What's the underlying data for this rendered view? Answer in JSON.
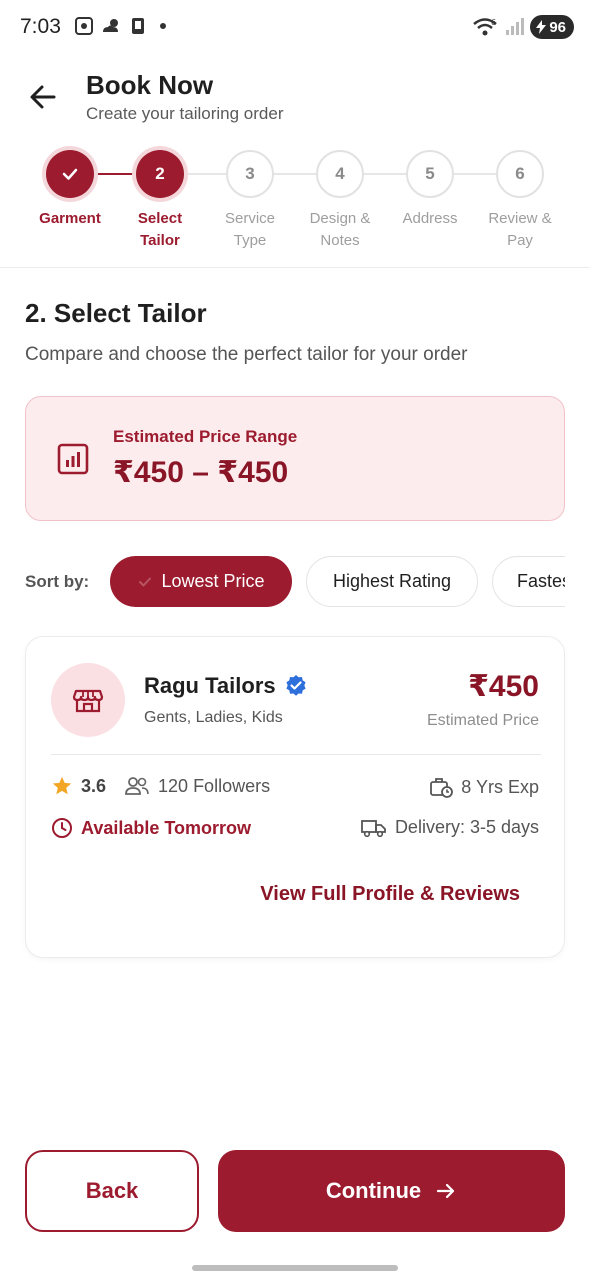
{
  "status_bar": {
    "time": "7:03",
    "battery": "96"
  },
  "header": {
    "title": "Book Now",
    "subtitle": "Create your tailoring order"
  },
  "stepper": [
    {
      "number": "1",
      "label_line1": "Garment",
      "label_line2": "",
      "state": "done"
    },
    {
      "number": "2",
      "label_line1": "Select",
      "label_line2": "Tailor",
      "state": "active"
    },
    {
      "number": "3",
      "label_line1": "Service",
      "label_line2": "Type",
      "state": "todo"
    },
    {
      "number": "4",
      "label_line1": "Design &",
      "label_line2": "Notes",
      "state": "todo"
    },
    {
      "number": "5",
      "label_line1": "Address",
      "label_line2": "",
      "state": "todo"
    },
    {
      "number": "6",
      "label_line1": "Review &",
      "label_line2": "Pay",
      "state": "todo"
    }
  ],
  "section": {
    "title": "2. Select Tailor",
    "description": "Compare and choose the perfect tailor for your order"
  },
  "price_range": {
    "label": "Estimated Price Range",
    "value": "₹450 – ₹450"
  },
  "sort": {
    "label": "Sort by:",
    "options": [
      "Lowest Price",
      "Highest Rating",
      "Fastest"
    ],
    "selected": "Lowest Price"
  },
  "tailor": {
    "name": "Ragu Tailors",
    "verified": true,
    "categories": "Gents, Ladies, Kids",
    "price": "₹450",
    "price_label": "Estimated Price",
    "rating": "3.6",
    "followers": "120 Followers",
    "experience": "8 Yrs Exp",
    "availability": "Available Tomorrow",
    "delivery": "Delivery: 3-5 days",
    "view_link": "View Full Profile & Reviews"
  },
  "footer": {
    "back_label": "Back",
    "continue_label": "Continue"
  },
  "colors": {
    "primary": "#9c1b2e",
    "price_bg": "#fdecee",
    "star": "#f2a623",
    "verified": "#2f6fdc"
  }
}
